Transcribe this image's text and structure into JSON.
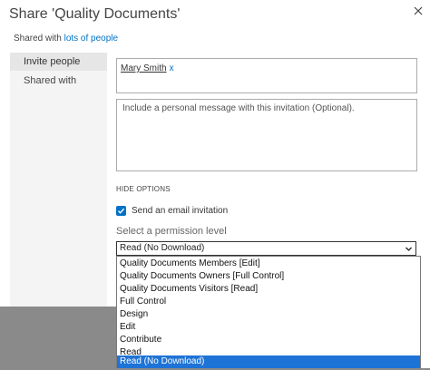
{
  "dialog": {
    "title": "Share 'Quality Documents'",
    "shared_prefix": "Shared with ",
    "shared_link": "lots of people"
  },
  "sidebar": {
    "items": [
      {
        "label": "Invite people"
      },
      {
        "label": "Shared with"
      }
    ]
  },
  "invite": {
    "person_name": "Mary Smith",
    "remove_label": "x",
    "message_placeholder": "Include a personal message with this invitation (Optional).",
    "hide_options_label": "HIDE OPTIONS",
    "send_email_label": "Send an email invitation",
    "send_email_checked": true,
    "permission_label": "Select a permission level",
    "permission_selected": "Read (No Download)",
    "permission_options": [
      "Quality Documents Members [Edit]",
      "Quality Documents Owners [Full Control]",
      "Quality Documents Visitors [Read]",
      "Full Control",
      "Design",
      "Edit",
      "Contribute",
      "Read",
      "Read (No Download)"
    ]
  },
  "colors": {
    "accent": "#0072c6",
    "selection": "#1e73d6",
    "backdrop": "#8a8a8a"
  },
  "icons": {
    "close": "close-icon",
    "check": "checkmark-icon",
    "chevron": "chevron-down-icon"
  }
}
